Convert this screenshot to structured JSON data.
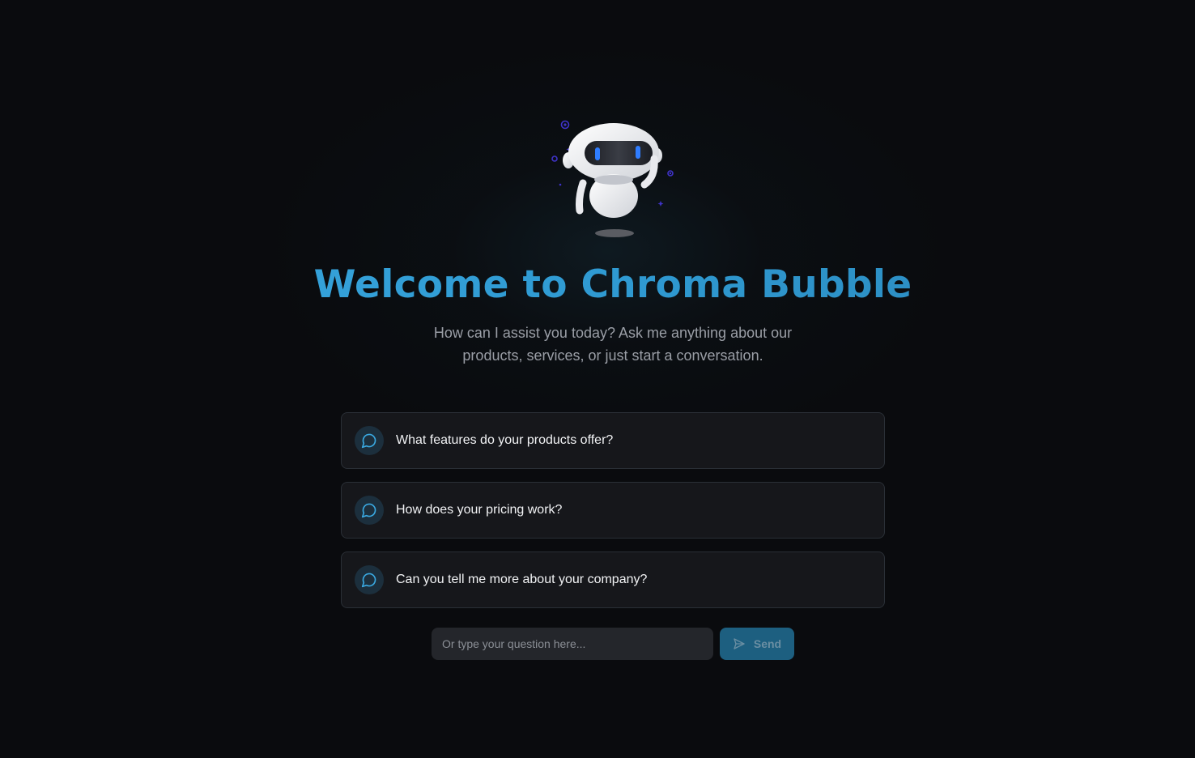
{
  "hero": {
    "title": "Welcome to Chroma Bubble",
    "subtitle": "How can I assist you today? Ask me anything about our products, services, or just start a conversation."
  },
  "suggestions": [
    {
      "text": "What features do your products offer?",
      "icon": "chat-bubble-icon"
    },
    {
      "text": "How does your pricing work?",
      "icon": "chat-bubble-icon"
    },
    {
      "text": "Can you tell me more about your company?",
      "icon": "chat-bubble-icon"
    }
  ],
  "composer": {
    "placeholder": "Or type your question here...",
    "value": "",
    "send_label": "Send",
    "send_icon": "paper-plane-icon"
  },
  "colors": {
    "background": "#0a0b0e",
    "accent": "#2f9ad2",
    "card": "#16171b",
    "send_button": "#1d5f80"
  }
}
